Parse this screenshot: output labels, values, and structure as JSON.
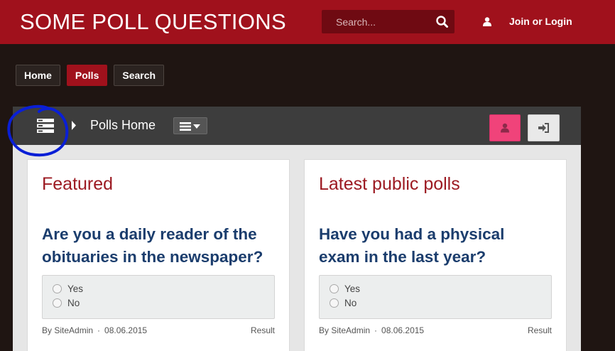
{
  "header": {
    "site_title": "SOME POLL QUESTIONS",
    "search_placeholder": "Search...",
    "search_icon": "search-icon",
    "user_icon": "user-icon",
    "login_label": "Join or Login"
  },
  "nav": {
    "items": [
      {
        "label": "Home",
        "active": false
      },
      {
        "label": "Polls",
        "active": true
      },
      {
        "label": "Search",
        "active": false
      }
    ]
  },
  "toolbar": {
    "title": "Polls Home",
    "list_icon": "list-icon",
    "arrow_icon": "caret-right-icon",
    "menu_icon": "menu-dropdown-icon",
    "pink_button_icon": "user-icon",
    "login_button_icon": "sign-in-icon"
  },
  "cards": [
    {
      "heading": "Featured",
      "question": "Are you a daily reader of the obituaries in the newspaper?",
      "options": [
        "Yes",
        "No"
      ],
      "author_prefix": "By ",
      "author": "SiteAdmin",
      "separator": "·",
      "date": "08.06.2015",
      "result_label": "Result"
    },
    {
      "heading": "Latest public polls",
      "question": "Have you had a physical exam in the last year?",
      "options": [
        "Yes",
        "No"
      ],
      "author_prefix": "By ",
      "author": "SiteAdmin",
      "separator": "·",
      "date": "08.06.2015",
      "result_label": "Result"
    }
  ],
  "colors": {
    "brand_red": "#a0111c",
    "page_bg": "#1f1512",
    "question_blue": "#1b3d6d",
    "heading_red": "#9c1a22",
    "pink_accent": "#f0437a",
    "annotation_blue": "#0a1fd6"
  }
}
